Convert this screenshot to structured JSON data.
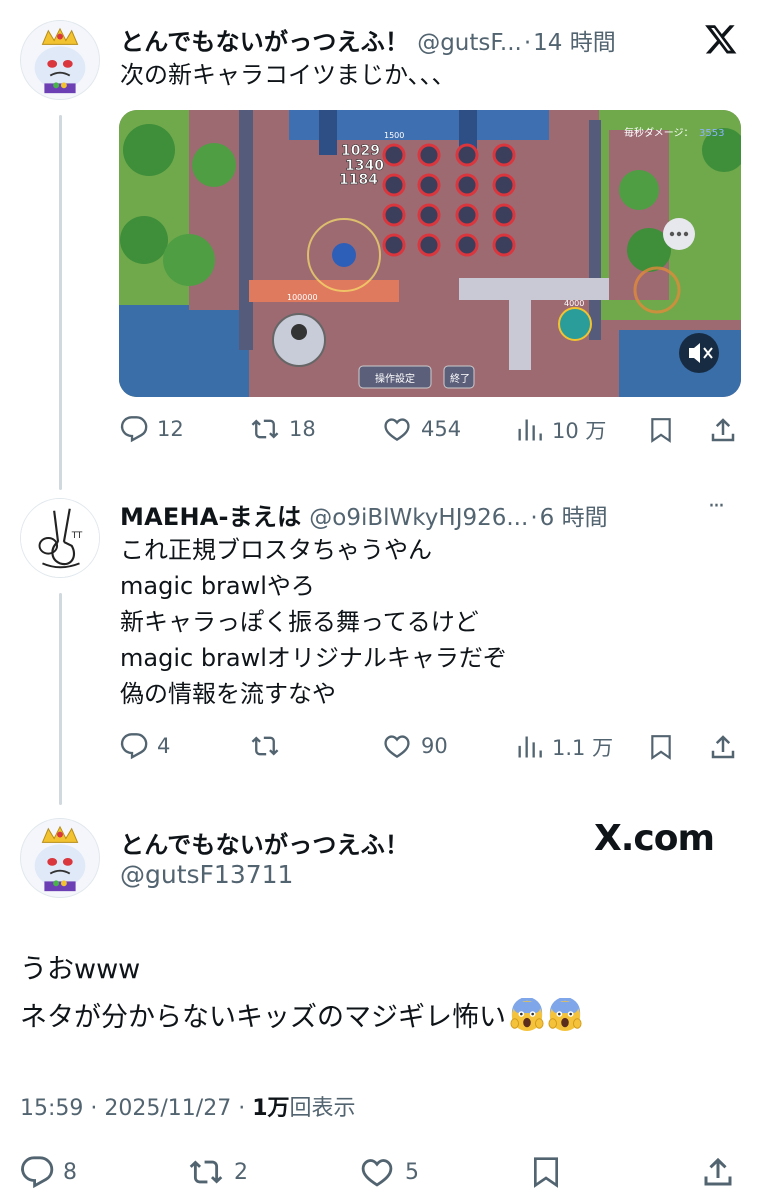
{
  "tweet1": {
    "display_name": "とんでもないがっつえふ！",
    "handle": "@gutsF...",
    "separator": "·",
    "time": "14 時間",
    "text": "次の新キャラコイツまじか、、、",
    "media": {
      "damage_label": "毎秒ダメージ：",
      "damage_value": "3553",
      "popup_1": "1029",
      "popup_2": "1340",
      "popup_3": "1184",
      "enemy_hp": "1500",
      "robot_hp": "100000",
      "player_hp": "4000",
      "button_1": "操作設定",
      "button_2": "終了"
    },
    "actions": {
      "replies": "12",
      "retweets": "18",
      "likes": "454",
      "views": "10 万"
    }
  },
  "tweet2": {
    "display_name": "MAEHA-まえは",
    "handle": "@o9iBlWkyHJ926...",
    "separator": "·",
    "time": "6 時間",
    "more": "···",
    "lines": [
      "これ正規ブロスタちゃうやん",
      "magic brawlやろ",
      "新キャラっぽく振る舞ってるけど",
      "magic brawlオリジナルキャラだぞ",
      "偽の情報を流すなや"
    ],
    "actions": {
      "replies": "4",
      "retweets": "",
      "likes": "90",
      "views": "1.1 万"
    }
  },
  "main_tweet": {
    "display_name": "とんでもないがっつえふ！",
    "handle": "@gutsF13711",
    "watermark": "X.com",
    "line1": "うおwww",
    "line2": "ネタが分からないキッズのマジギレ怖い",
    "time": "15:59",
    "dot": "·",
    "date": "2025/11/27",
    "views_count": "1万",
    "views_label": "回表示",
    "actions": {
      "replies": "8",
      "retweets": "2",
      "likes": "5"
    }
  },
  "icons": [
    "x-logo-icon",
    "reply-icon",
    "retweet-icon",
    "like-icon",
    "views-icon",
    "bookmark-icon",
    "share-icon",
    "mute-icon",
    "chat-bubble-icon",
    "more-icon",
    "fear-emoji-icon"
  ]
}
